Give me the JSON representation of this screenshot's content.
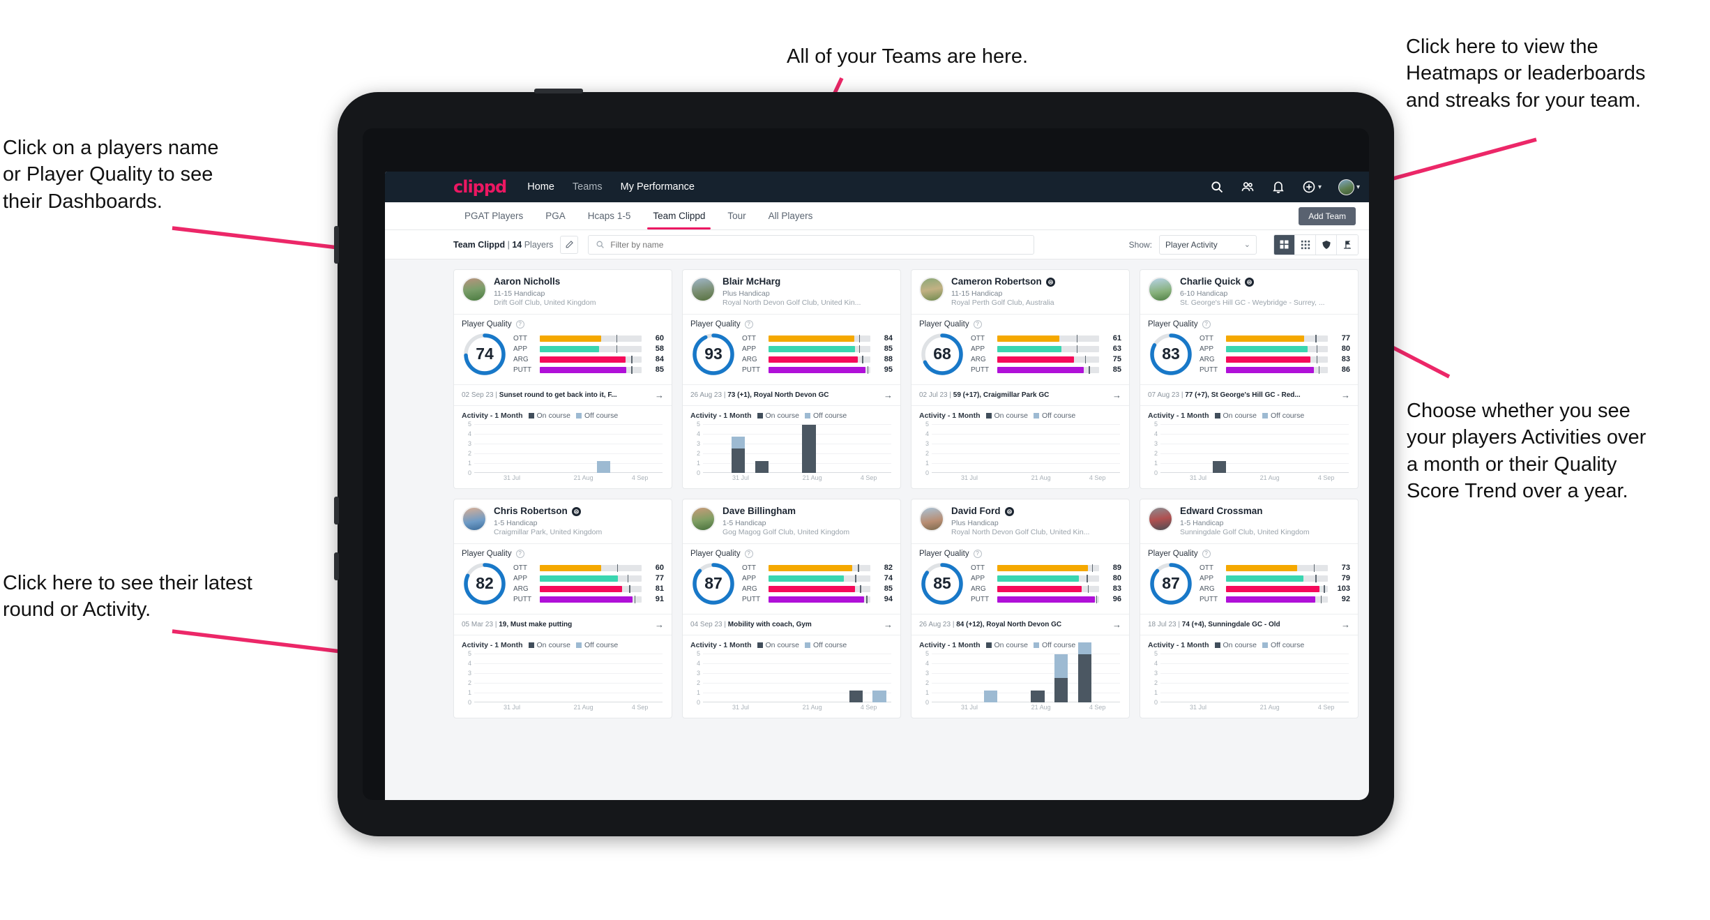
{
  "annotations": [
    {
      "id": "ann-teams",
      "text": "All of your Teams are here."
    },
    {
      "id": "ann-heatmaps",
      "text": "Click here to view the\nHeatmaps or leaderboards\nand streaks for your team."
    },
    {
      "id": "ann-names",
      "text": "Click on a players name\nor Player Quality to see\ntheir Dashboards."
    },
    {
      "id": "ann-show",
      "text": "Choose whether you see\nyour players Activities over\na month or their Quality\nScore Trend over a year."
    },
    {
      "id": "ann-latest",
      "text": "Click here to see their latest\nround or Activity."
    }
  ],
  "navbar": {
    "brand": "clippd",
    "links": [
      {
        "label": "Home",
        "active": true
      },
      {
        "label": "Teams",
        "active": false
      },
      {
        "label": "My Performance",
        "active": true
      }
    ],
    "icons": [
      "search-icon",
      "people-icon",
      "bell-icon",
      "plus-circle-icon",
      "avatar"
    ]
  },
  "tabs": [
    {
      "label": "PGAT Players",
      "active": false
    },
    {
      "label": "PGA",
      "active": false
    },
    {
      "label": "Hcaps 1-5",
      "active": false
    },
    {
      "label": "Team Clippd",
      "active": true
    },
    {
      "label": "Tour",
      "active": false
    },
    {
      "label": "All Players",
      "active": false
    }
  ],
  "add_team_button": "Add Team",
  "toolbar": {
    "team_name": "Team Clippd",
    "separator": "|",
    "player_count": "14",
    "players_word": "Players",
    "search_placeholder": "Filter by name",
    "search_value": "",
    "show_label": "Show:",
    "show_value": "Player Activity",
    "show_options": [
      "Player Activity",
      "Quality Score Trend"
    ],
    "view_toggles": [
      {
        "name": "grid-view-icon",
        "active": true
      },
      {
        "name": "table-view-icon",
        "active": false
      },
      {
        "name": "heatmap-shield-icon",
        "active": false
      },
      {
        "name": "leaderboard-flag-icon",
        "active": false
      }
    ]
  },
  "quality": {
    "title": "Player Quality",
    "help_icon": "question-icon"
  },
  "activity": {
    "title": "Activity - 1 Month",
    "legend_on": "On course",
    "legend_off": "Off course",
    "y_ticks": [
      "5",
      "4",
      "3",
      "2",
      "1",
      "0"
    ],
    "x_ticks": [
      "31 Jul",
      "21 Aug",
      "4 Sep"
    ]
  },
  "colors": {
    "accent": "#ec1762",
    "navbar": "#16222e",
    "ring": "#1878c8",
    "ott": "#f5a800",
    "app": "#3ad6b0",
    "arg": "#f50a5a",
    "putt": "#b010d8",
    "on_course": "#4b5762",
    "off_course": "#9dbad2"
  },
  "chart_data": {
    "type": "bar",
    "title": "Activity - 1 Month",
    "ylabel": "",
    "xlabel": "",
    "ylim": [
      0,
      5
    ],
    "grid": true,
    "legend": [
      "On course",
      "Off course"
    ],
    "x_tick_labels": [
      "31 Jul",
      "21 Aug",
      "4 Sep"
    ],
    "charts": [
      {
        "player": "Aaron Nicholls",
        "bins": 8,
        "on_course": [
          0,
          0,
          0,
          0,
          0,
          0,
          0,
          0
        ],
        "off_course": [
          0,
          0,
          0,
          0,
          0,
          1,
          0,
          0
        ]
      },
      {
        "player": "Blair McHarg",
        "bins": 8,
        "on_course": [
          0,
          2,
          1,
          0,
          4,
          0,
          0,
          0
        ],
        "off_course": [
          0,
          1,
          0,
          0,
          0,
          0,
          0,
          0
        ]
      },
      {
        "player": "Cameron Robertson",
        "bins": 8,
        "on_course": [
          0,
          0,
          0,
          0,
          0,
          0,
          0,
          0
        ],
        "off_course": [
          0,
          0,
          0,
          0,
          0,
          0,
          0,
          0
        ]
      },
      {
        "player": "Charlie Quick",
        "bins": 8,
        "on_course": [
          0,
          0,
          1,
          0,
          0,
          0,
          0,
          0
        ],
        "off_course": [
          0,
          0,
          0,
          0,
          0,
          0,
          0,
          0
        ]
      },
      {
        "player": "Chris Robertson",
        "bins": 8,
        "on_course": [
          0,
          0,
          0,
          0,
          0,
          0,
          0,
          0
        ],
        "off_course": [
          0,
          0,
          0,
          0,
          0,
          0,
          0,
          0
        ]
      },
      {
        "player": "Dave Billingham",
        "bins": 8,
        "on_course": [
          0,
          0,
          0,
          0,
          0,
          0,
          1,
          0
        ],
        "off_course": [
          0,
          0,
          0,
          0,
          0,
          0,
          0,
          1
        ]
      },
      {
        "player": "David Ford",
        "bins": 8,
        "on_course": [
          0,
          0,
          0,
          0,
          1,
          2,
          4,
          0
        ],
        "off_course": [
          0,
          0,
          1,
          0,
          0,
          2,
          1,
          0
        ]
      },
      {
        "player": "Edward Crossman",
        "bins": 8,
        "on_course": [
          0,
          0,
          0,
          0,
          0,
          0,
          0,
          0
        ],
        "off_course": [
          0,
          0,
          0,
          0,
          0,
          0,
          0,
          0
        ]
      }
    ]
  },
  "players": [
    {
      "name": "Aaron Nicholls",
      "verified": false,
      "avatar": "av1",
      "handicap": "11-15 Handicap",
      "club": "Drift Golf Club, United Kingdom",
      "score": "74",
      "ring_pct": 74,
      "metrics": [
        {
          "label": "OTT",
          "value": "60",
          "pct": 60,
          "tick": 75,
          "color": "#f5a800"
        },
        {
          "label": "APP",
          "value": "58",
          "pct": 58,
          "tick": 75,
          "color": "#3ad6b0"
        },
        {
          "label": "ARG",
          "value": "84",
          "pct": 84,
          "tick": 90,
          "color": "#f50a5a"
        },
        {
          "label": "PUTT",
          "value": "85",
          "pct": 85,
          "tick": 90,
          "color": "#b010d8"
        }
      ],
      "latest_date": "02 Sep 23",
      "latest_text": "Sunset round to get back into it, F..."
    },
    {
      "name": "Blair McHarg",
      "verified": false,
      "avatar": "av2",
      "handicap": "Plus Handicap",
      "club": "Royal North Devon Golf Club, United Kin...",
      "score": "93",
      "ring_pct": 93,
      "metrics": [
        {
          "label": "OTT",
          "value": "84",
          "pct": 84,
          "tick": 89,
          "color": "#f5a800"
        },
        {
          "label": "APP",
          "value": "85",
          "pct": 85,
          "tick": 89,
          "color": "#3ad6b0"
        },
        {
          "label": "ARG",
          "value": "88",
          "pct": 88,
          "tick": 92,
          "color": "#f50a5a"
        },
        {
          "label": "PUTT",
          "value": "95",
          "pct": 95,
          "tick": 97,
          "color": "#b010d8"
        }
      ],
      "latest_date": "26 Aug 23",
      "latest_text": "73 (+1), Royal North Devon GC"
    },
    {
      "name": "Cameron Robertson",
      "verified": true,
      "avatar": "av3",
      "handicap": "11-15 Handicap",
      "club": "Royal Perth Golf Club, Australia",
      "score": "68",
      "ring_pct": 68,
      "metrics": [
        {
          "label": "OTT",
          "value": "61",
          "pct": 61,
          "tick": 78,
          "color": "#f5a800"
        },
        {
          "label": "APP",
          "value": "63",
          "pct": 63,
          "tick": 78,
          "color": "#3ad6b0"
        },
        {
          "label": "ARG",
          "value": "75",
          "pct": 75,
          "tick": 86,
          "color": "#f50a5a"
        },
        {
          "label": "PUTT",
          "value": "85",
          "pct": 85,
          "tick": 90,
          "color": "#b010d8"
        }
      ],
      "latest_date": "02 Jul 23",
      "latest_text": "59 (+17), Craigmillar Park GC"
    },
    {
      "name": "Charlie Quick",
      "verified": true,
      "avatar": "av4",
      "handicap": "6-10 Handicap",
      "club": "St. George's Hill GC - Weybridge - Surrey, ...",
      "score": "83",
      "ring_pct": 83,
      "metrics": [
        {
          "label": "OTT",
          "value": "77",
          "pct": 77,
          "tick": 88,
          "color": "#f5a800"
        },
        {
          "label": "APP",
          "value": "80",
          "pct": 80,
          "tick": 89,
          "color": "#3ad6b0"
        },
        {
          "label": "ARG",
          "value": "83",
          "pct": 83,
          "tick": 89,
          "color": "#f50a5a"
        },
        {
          "label": "PUTT",
          "value": "86",
          "pct": 86,
          "tick": 91,
          "color": "#b010d8"
        }
      ],
      "latest_date": "07 Aug 23",
      "latest_text": "77 (+7), St George's Hill GC - Red..."
    },
    {
      "name": "Chris Robertson",
      "verified": true,
      "avatar": "av5",
      "handicap": "1-5 Handicap",
      "club": "Craigmillar Park, United Kingdom",
      "score": "82",
      "ring_pct": 82,
      "metrics": [
        {
          "label": "OTT",
          "value": "60",
          "pct": 60,
          "tick": 76,
          "color": "#f5a800"
        },
        {
          "label": "APP",
          "value": "77",
          "pct": 77,
          "tick": 86,
          "color": "#3ad6b0"
        },
        {
          "label": "ARG",
          "value": "81",
          "pct": 81,
          "tick": 88,
          "color": "#f50a5a"
        },
        {
          "label": "PUTT",
          "value": "91",
          "pct": 91,
          "tick": 93,
          "color": "#b010d8"
        }
      ],
      "latest_date": "05 Mar 23",
      "latest_text": "19, Must make putting"
    },
    {
      "name": "Dave Billingham",
      "verified": false,
      "avatar": "av6",
      "handicap": "1-5 Handicap",
      "club": "Gog Magog Golf Club, United Kingdom",
      "score": "87",
      "ring_pct": 87,
      "metrics": [
        {
          "label": "OTT",
          "value": "82",
          "pct": 82,
          "tick": 88,
          "color": "#f5a800"
        },
        {
          "label": "APP",
          "value": "74",
          "pct": 74,
          "tick": 85,
          "color": "#3ad6b0"
        },
        {
          "label": "ARG",
          "value": "85",
          "pct": 85,
          "tick": 90,
          "color": "#f50a5a"
        },
        {
          "label": "PUTT",
          "value": "94",
          "pct": 94,
          "tick": 96,
          "color": "#b010d8"
        }
      ],
      "latest_date": "04 Sep 23",
      "latest_text": "Mobility with coach, Gym"
    },
    {
      "name": "David Ford",
      "verified": true,
      "avatar": "av7",
      "handicap": "Plus Handicap",
      "club": "Royal North Devon Golf Club, United Kin...",
      "score": "85",
      "ring_pct": 85,
      "metrics": [
        {
          "label": "OTT",
          "value": "89",
          "pct": 89,
          "tick": 93,
          "color": "#f5a800"
        },
        {
          "label": "APP",
          "value": "80",
          "pct": 80,
          "tick": 88,
          "color": "#3ad6b0"
        },
        {
          "label": "ARG",
          "value": "83",
          "pct": 83,
          "tick": 89,
          "color": "#f50a5a"
        },
        {
          "label": "PUTT",
          "value": "96",
          "pct": 96,
          "tick": 97,
          "color": "#b010d8"
        }
      ],
      "latest_date": "26 Aug 23",
      "latest_text": "84 (+12), Royal North Devon GC"
    },
    {
      "name": "Edward Crossman",
      "verified": false,
      "avatar": "av8",
      "handicap": "1-5 Handicap",
      "club": "Sunningdale Golf Club, United Kingdom",
      "score": "87",
      "ring_pct": 87,
      "metrics": [
        {
          "label": "OTT",
          "value": "73",
          "pct": 70,
          "tick": 86,
          "color": "#f5a800"
        },
        {
          "label": "APP",
          "value": "79",
          "pct": 76,
          "tick": 88,
          "color": "#3ad6b0"
        },
        {
          "label": "ARG",
          "value": "103",
          "pct": 92,
          "tick": 96,
          "color": "#f50a5a"
        },
        {
          "label": "PUTT",
          "value": "92",
          "pct": 88,
          "tick": 93,
          "color": "#b010d8"
        }
      ],
      "latest_date": "18 Jul 23",
      "latest_text": "74 (+4), Sunningdale GC - Old"
    }
  ]
}
